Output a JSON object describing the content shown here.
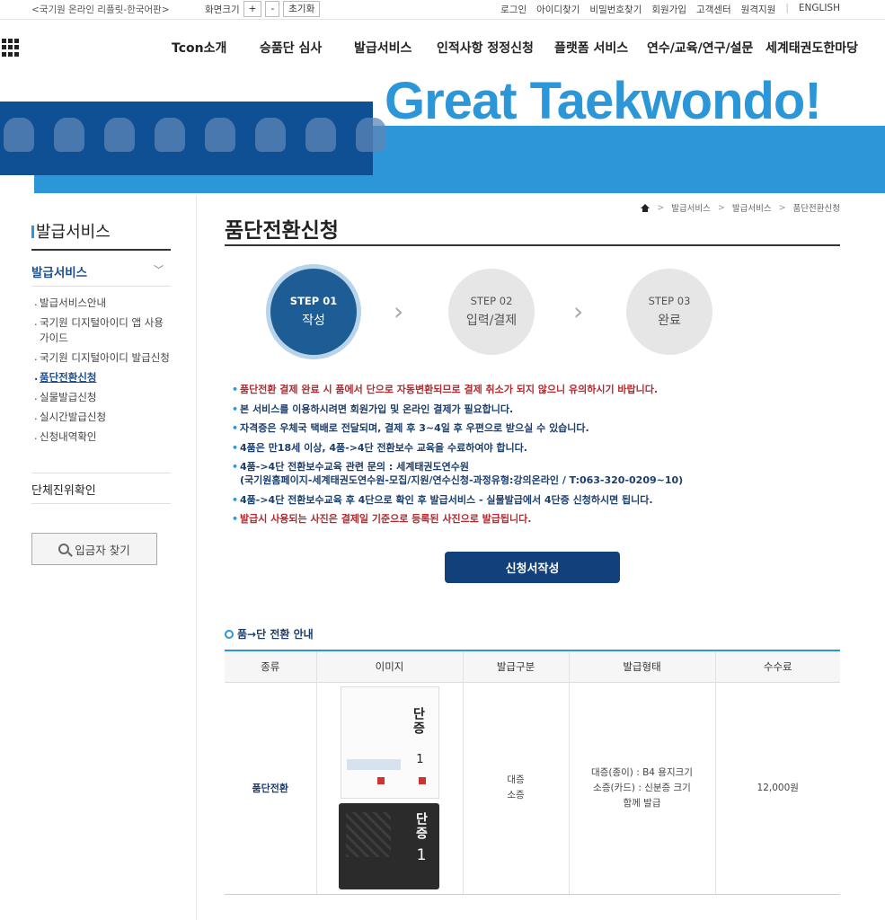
{
  "topbar": {
    "legacy_link": "<국기원 온라인 리플릿-한국어판>",
    "zoom_label": "화면크기",
    "zoom_plus": "+",
    "zoom_minus": "-",
    "zoom_reset": "초기화",
    "links": [
      "로그인",
      "아이디찾기",
      "비밀번호찾기",
      "회원가입",
      "고객센터",
      "원격지원",
      "ENGLISH"
    ]
  },
  "gnb": {
    "menus": [
      "Tcon소개",
      "승품단 심사",
      "발급서비스",
      "인적사항 정정신청",
      "플랫폼 서비스",
      "연수/교육/연구/설문",
      "세계태권도한마당"
    ]
  },
  "banner": {
    "slogan": "Great Taekwondo!"
  },
  "side": {
    "title": "발급서비스",
    "group": "발급서비스",
    "items": [
      {
        "label": "발급서비스안내",
        "active": false
      },
      {
        "label": "국기원 디지털아이디 앱 사용 가이드",
        "active": false
      },
      {
        "label": "국기원 디지털아이디 발급신청",
        "active": false
      },
      {
        "label": "품단전환신청",
        "active": true
      },
      {
        "label": "실물발급신청",
        "active": false
      },
      {
        "label": "실시간발급신청",
        "active": false
      },
      {
        "label": "신청내역확인",
        "active": false
      }
    ],
    "group2": "단체진위확인",
    "find_button": "입금자 찾기"
  },
  "breadcrumb": [
    "발급서비스",
    "발급서비스",
    "품단전환신청"
  ],
  "page_title": "품단전환신청",
  "steps": [
    {
      "num": "STEP 01",
      "label": "작성",
      "active": true
    },
    {
      "num": "STEP 02",
      "label": "입력/결제",
      "active": false
    },
    {
      "num": "STEP 03",
      "label": "완료",
      "active": false
    }
  ],
  "notes": [
    {
      "text": "품단전환 결제 완료 시 품에서 단으로 자동변환되므로 결제 취소가 되지 않으니 유의하시기 바랍니다.",
      "red": true
    },
    {
      "text": "본 서비스를 이용하시려면 회원가입 및 온라인 결제가 필요합니다.",
      "red": false
    },
    {
      "text": "자격증은 우체국 택배로 전달되며, 결제 후 3~4일 후 우편으로 받으실 수 있습니다.",
      "red": false
    },
    {
      "text": "4품은 만18세 이상, 4품->4단 전환보수 교육을 수료하여야 합니다.",
      "red": false
    },
    {
      "text": "4품->4단 전환보수교육 관련 문의 : 세계태권도연수원",
      "line2": "(국기원홈페이지-세계태권도연수원-모집/지원/연수신청-과정유형:강의온라인 / T:063-320-0209~10)",
      "red": false
    },
    {
      "text": "4품->4단 전환보수교육 후 4단으로 확인 후 발급서비스 - 실물발급에서 4단증 신청하시면 됩니다.",
      "red": false
    },
    {
      "text": "발급시 사용되는 사진은 결제일 기준으로 등록된 사진으로 발급됩니다.",
      "red": true
    }
  ],
  "apply_button": "신청서작성",
  "section_title": "품→단 전환 안내",
  "table": {
    "headers": [
      "종류",
      "이미지",
      "발급구분",
      "발급형태",
      "수수료"
    ],
    "row": {
      "kind": "품단전환",
      "cert_title": "단증",
      "cert_num": "1",
      "division": [
        "대증",
        "소증"
      ],
      "form": [
        "대증(종이) : B4 용지크기",
        "소증(카드) : 신분증 크기",
        "함께 발급"
      ],
      "fee": "12,000원"
    }
  },
  "colors": {
    "accent": "#2b97d9",
    "navy": "#12407a",
    "alert": "#b2292e"
  }
}
